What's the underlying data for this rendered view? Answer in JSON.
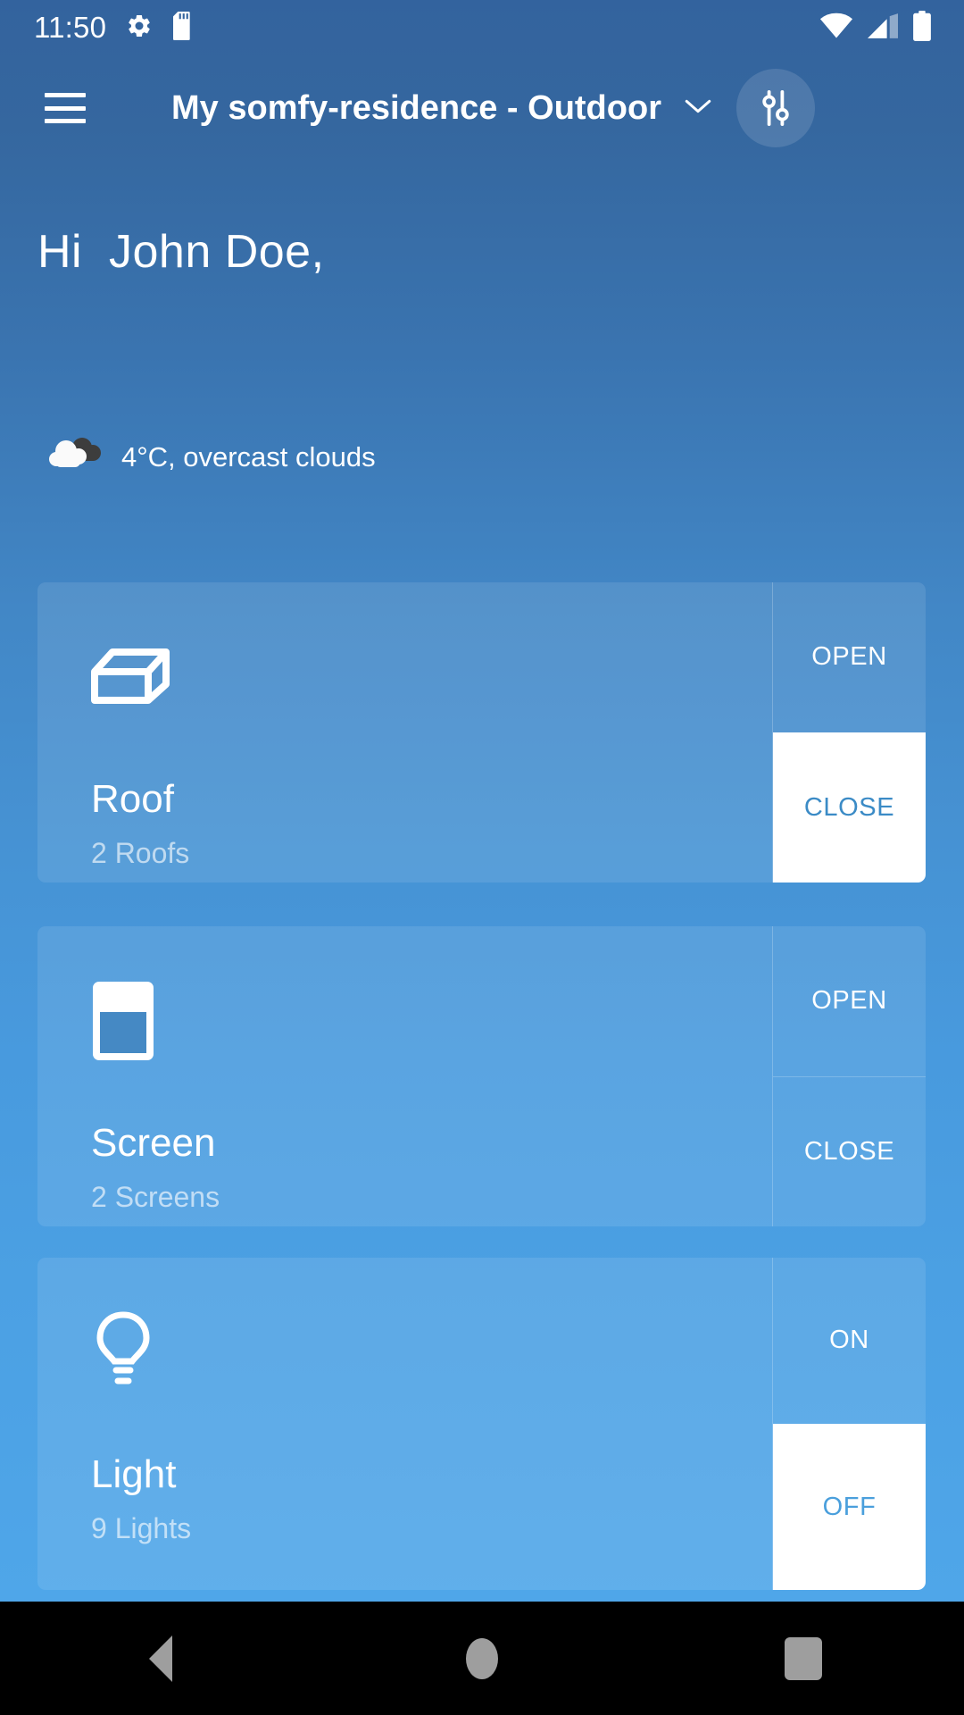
{
  "status_bar": {
    "clock": "11:50",
    "icons_left": [
      "gear-icon",
      "sd-card-icon"
    ],
    "icons_right": [
      "wifi-icon",
      "cellular-signal-icon",
      "battery-icon"
    ]
  },
  "app_bar": {
    "menu_icon": "hamburger-menu-icon",
    "title": "My somfy-residence - Outdoor",
    "dropdown_icon": "chevron-down-icon",
    "action_icon": "tune-sliders-icon"
  },
  "greeting": "Hi  John Doe,",
  "weather": {
    "icon": "overcast-clouds-icon",
    "text": "4°C, overcast clouds",
    "temperature": "4°C",
    "condition": "overcast clouds"
  },
  "colors": {
    "background_top": "#33639e",
    "background_bottom": "#4fa6e9",
    "card_overlay": "rgba(255,255,255,0.10)",
    "active_button_bg": "#ffffff",
    "roof_active_text": "#3b8bc6",
    "light_active_text": "#4a9fdc",
    "nav_icon": "#9e9e9e"
  },
  "cards": [
    {
      "id": "roof",
      "icon": "roof-pergola-icon",
      "title": "Roof",
      "subtitle": "2 Roofs",
      "actions": [
        {
          "label": "OPEN",
          "active": false
        },
        {
          "label": "CLOSE",
          "active": true
        }
      ]
    },
    {
      "id": "screen",
      "icon": "screen-blind-icon",
      "title": "Screen",
      "subtitle": "2 Screens",
      "actions": [
        {
          "label": "OPEN",
          "active": false
        },
        {
          "label": "CLOSE",
          "active": false
        }
      ]
    },
    {
      "id": "light",
      "icon": "light-bulb-icon",
      "title": "Light",
      "subtitle": "9 Lights",
      "actions": [
        {
          "label": "ON",
          "active": false
        },
        {
          "label": "OFF",
          "active": true
        }
      ]
    }
  ],
  "nav_bar": {
    "back": "back-triangle-icon",
    "home": "home-circle-icon",
    "recents": "recents-square-icon"
  }
}
